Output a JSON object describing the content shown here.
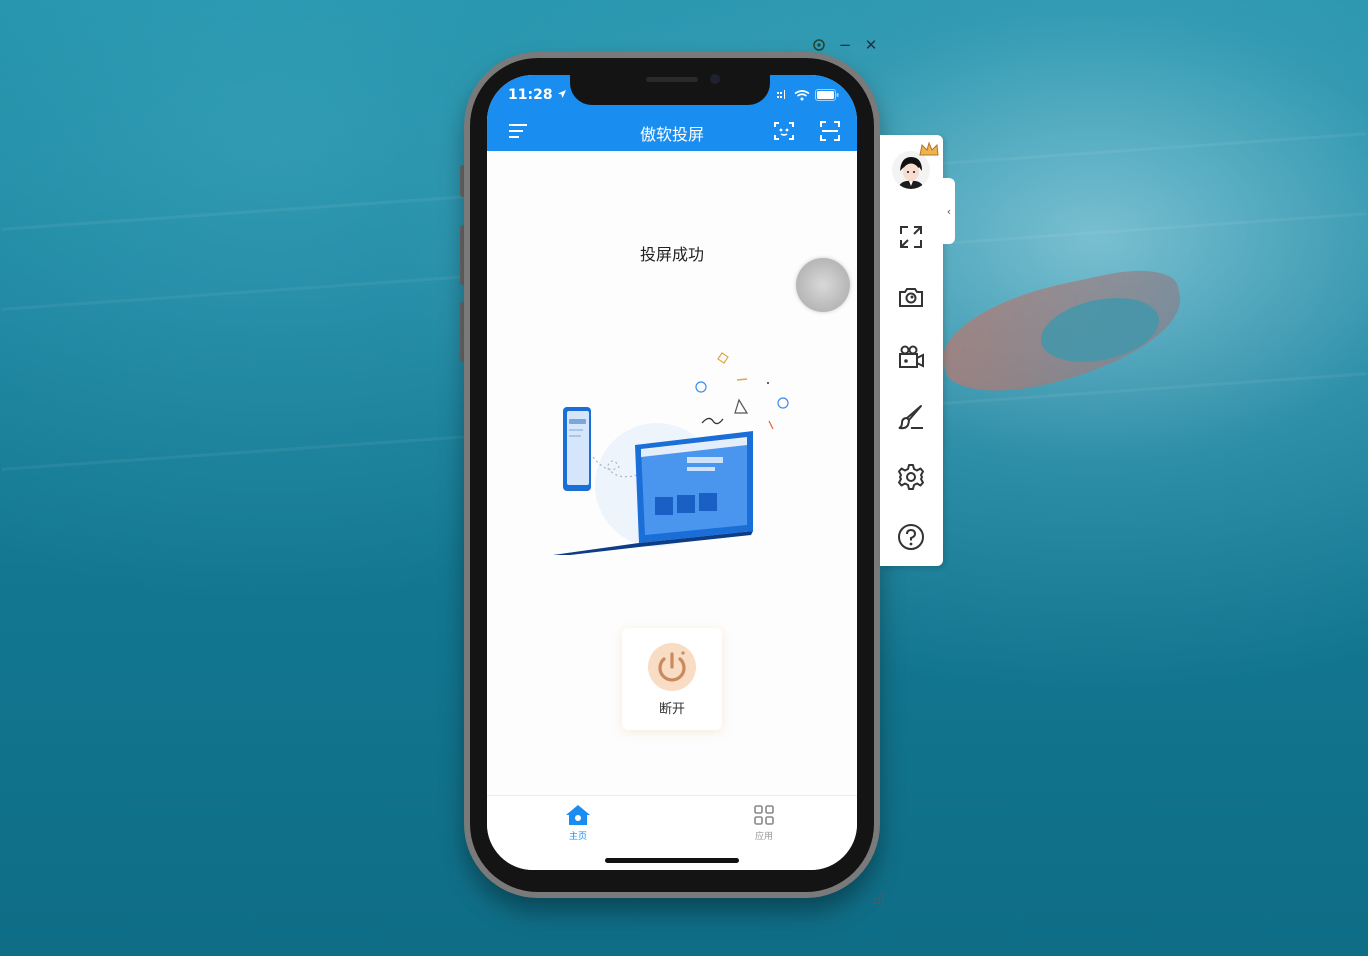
{
  "window_controls": {
    "pin_icon": "pin-icon",
    "minimize": "−",
    "close": "✕"
  },
  "phone": {
    "status_bar": {
      "time": "11:28",
      "location_icon": "location-arrow-icon",
      "signal_icon": "cellular-icon",
      "wifi_icon": "wifi-icon",
      "battery_icon": "battery-icon"
    },
    "header": {
      "title": "傲软投屏",
      "menu_icon": "menu-icon",
      "cast_icon": "screen-cast-icon",
      "scan_icon": "scan-icon"
    },
    "main": {
      "status_text": "投屏成功",
      "illustration": "phone-to-laptop-illustration",
      "disconnect_label": "断开",
      "disconnect_icon": "power-icon"
    },
    "tabbar": {
      "tabs": [
        {
          "label": "主页",
          "icon": "home-icon",
          "active": true
        },
        {
          "label": "应用",
          "icon": "apps-grid-icon",
          "active": false
        }
      ]
    }
  },
  "toolbar": {
    "items": [
      {
        "name": "avatar",
        "icon": "user-avatar-icon"
      },
      {
        "name": "fullscreen",
        "icon": "expand-icon"
      },
      {
        "name": "screenshot",
        "icon": "camera-icon"
      },
      {
        "name": "record",
        "icon": "video-camera-icon"
      },
      {
        "name": "draw",
        "icon": "brush-icon"
      },
      {
        "name": "settings",
        "icon": "gear-icon"
      },
      {
        "name": "help",
        "icon": "help-icon"
      }
    ],
    "collapse_glyph": "‹"
  },
  "colors": {
    "accent": "#1a8df0",
    "disconnect": "#c98b5e",
    "tab_inactive": "#999999"
  }
}
